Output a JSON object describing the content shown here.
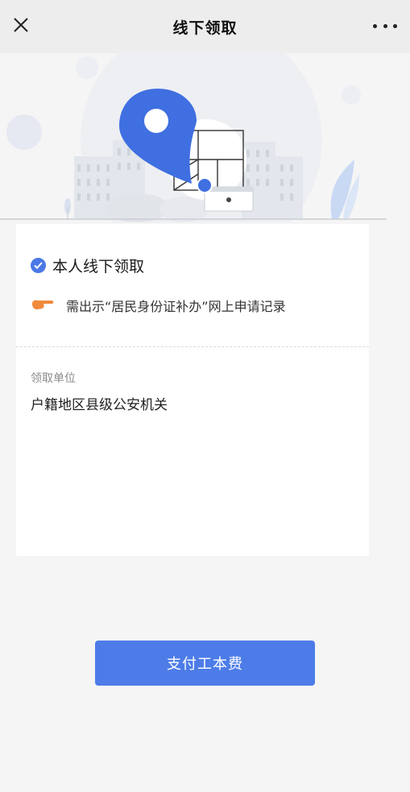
{
  "navbar": {
    "title": "线下领取",
    "close_icon": "close-icon",
    "more_icon": "more-dots-icon"
  },
  "hero": {
    "illustration": "location-pin-building-illustration"
  },
  "option": {
    "label": "本人线下领取",
    "icon": "checkmark-circle-icon"
  },
  "hint": {
    "icon": "pointing-hand-icon",
    "text": "需出示“居民身份证补办”网上申请记录"
  },
  "pickup_unit": {
    "label": "领取单位",
    "value": "户籍地区县级公安机关"
  },
  "pay_button": {
    "label": "支付工本费"
  },
  "colors": {
    "accent": "#4d7ce8",
    "check": "#4a78e6",
    "hand": "#f08a3c",
    "navbar_bg": "#ededed",
    "page_bg": "#f5f5f5"
  }
}
